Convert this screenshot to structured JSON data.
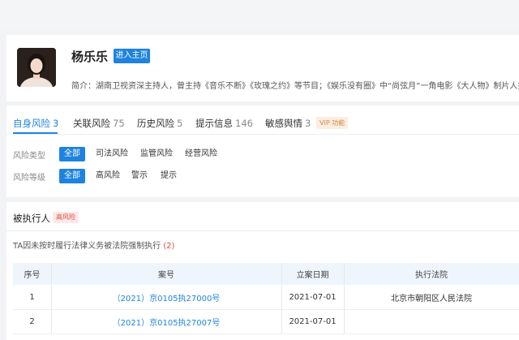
{
  "profile": {
    "name": "杨乐乐",
    "home_button": "进入主页",
    "bio": "简介：湖南卫视资深主持人，曾主持《音乐不断》《玫瑰之约》等节目；《娱乐没有圈》中“尚弦月”一角电影《大人物》制片人投..."
  },
  "tabs": [
    {
      "label": "自身风险",
      "count": "3"
    },
    {
      "label": "关联风险",
      "count": "75"
    },
    {
      "label": "历史风险",
      "count": "5"
    },
    {
      "label": "提示信息",
      "count": "146"
    },
    {
      "label": "敏感舆情",
      "count": "3"
    }
  ],
  "vip_badge": "VIP 功能",
  "filters": {
    "risk_type": {
      "label": "风险类型",
      "options": [
        "全部",
        "司法风险",
        "监管风险",
        "经营风险"
      ]
    },
    "risk_level": {
      "label": "风险等级",
      "options": [
        "全部",
        "高风险",
        "警示",
        "提示"
      ]
    }
  },
  "section": {
    "title": "被执行人",
    "badge": "高风险",
    "desc": "TA因未按时履行法律义务被法院强制执行",
    "desc_count": "(2)"
  },
  "table": {
    "headers": [
      "序号",
      "案号",
      "立案日期",
      "执行法院"
    ],
    "rows": [
      [
        "1",
        "（2021）京0105执27000号",
        "2021-07-01",
        "北京市朝阳区人民法院"
      ],
      [
        "2",
        "（2021）京0105执27007号",
        "2021-07-01",
        ""
      ]
    ]
  },
  "colors": {
    "accent": "#1e83e0",
    "danger": "#e24a44",
    "vip": "#d28a3d"
  }
}
